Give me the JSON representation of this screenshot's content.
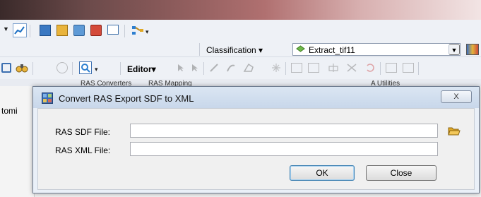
{
  "toolbar": {
    "classification_label": "Classification",
    "layer_name": "Extract_tif11",
    "editor_label": "Editor",
    "strip_left": "RAS Converters",
    "strip_mid": "RAS Mapping",
    "strip_right": "A Utilities",
    "icons": [
      "dropdown-icon",
      "chart-icon",
      "table-icon",
      "report-icon",
      "graph-icon",
      "map-icon",
      "window-icon",
      "flowchart-icon",
      "hierarchy-icon",
      "binoculars-icon",
      "layer-icon",
      "zoom-icon",
      "edit-pointer-icon",
      "sketch-icon",
      "draw-icon",
      "vertex-icon",
      "split-icon",
      "reshape-icon",
      "attributes-icon"
    ]
  },
  "left_pane": {
    "partial_text": "tomi"
  },
  "dialog": {
    "title": "Convert RAS Export SDF to XML",
    "close_label": "X",
    "sdf_label": "RAS SDF File:",
    "sdf_value": "",
    "xml_label": "RAS XML File:",
    "xml_value": "",
    "ok_label": "OK",
    "close_button_label": "Close"
  },
  "colors": {
    "dialog_frame": "#eaf0f8",
    "toolbar_bg": "#eef1f6",
    "folder_icon": "#e0a825"
  }
}
